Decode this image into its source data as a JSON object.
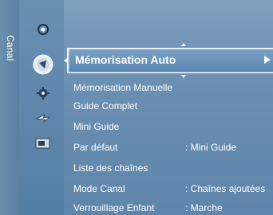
{
  "sidebar": {
    "category_label": "Canal",
    "icons": [
      {
        "name": "picture-icon"
      },
      {
        "name": "channel-icon"
      },
      {
        "name": "setup-icon"
      },
      {
        "name": "input-icon"
      },
      {
        "name": "application-icon"
      }
    ]
  },
  "menu": {
    "selected": {
      "label": "Mémorisation Auto"
    },
    "items": [
      {
        "label": "Mémorisation Manuelle",
        "value": ""
      },
      {
        "label": "Guide Complet",
        "value": ""
      },
      {
        "label": "Mini Guide",
        "value": ""
      },
      {
        "label": "Par défaut",
        "value": ": Mini Guide"
      },
      {
        "label": "Liste des chaînes",
        "value": ""
      },
      {
        "label": "Mode Canal",
        "value": ": Chaînes ajoutées"
      },
      {
        "label": "Verrouillage Enfant",
        "value": ": Marche"
      }
    ]
  }
}
